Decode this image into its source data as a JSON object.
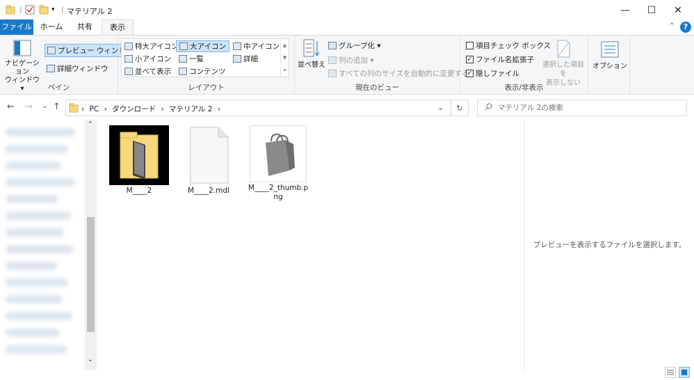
{
  "window": {
    "title": "マテリアル 2",
    "minimize_glyph": "—",
    "maximize_glyph": "☐",
    "close_glyph": "✕"
  },
  "tabs": [
    {
      "label": "ファイル"
    },
    {
      "label": "ホーム"
    },
    {
      "label": "共有"
    },
    {
      "label": "表示"
    }
  ],
  "help_glyph": "?",
  "ribbon": {
    "pane": {
      "label": "ペイン",
      "nav_pane_line1": "ナビゲーション",
      "nav_pane_line2": "ウィンドウ▾",
      "preview_pane": "プレビュー ウィンドウ",
      "details_pane": "詳細ウィンドウ"
    },
    "layout": {
      "label": "レイアウト",
      "items": [
        "特大アイコン",
        "大アイコン",
        "中アイコン",
        "小アイコン",
        "一覧",
        "詳細",
        "並べて表示",
        "コンテンツ"
      ]
    },
    "current_view": {
      "label": "現在のビュー",
      "sort_by": "並べ替え",
      "group_by": "グループ化 ▾",
      "add_columns": "列の追加 ▾",
      "fit_columns": "すべての列のサイズを自動的に変更する"
    },
    "show_hide": {
      "label": "表示/非表示",
      "item_checkboxes": "項目チェック ボックス",
      "item_checkboxes_checked": false,
      "file_extensions": "ファイル名拡張子",
      "file_extensions_checked": true,
      "hidden_items": "隠しファイル",
      "hidden_items_checked": true,
      "hide_selected_line1": "選択した項目を",
      "hide_selected_line2": "表示しない"
    },
    "options": "オプション"
  },
  "nav": {
    "back": "←",
    "forward": "→",
    "recent": "⌄",
    "up": "↑",
    "breadcrumb": [
      "PC",
      "ダウンロード",
      "マテリアル 2"
    ],
    "separator": "›",
    "refresh_glyph": "↻",
    "search_placeholder": "マテリアル 2の検索"
  },
  "files": [
    {
      "name": "M____2",
      "type": "folder"
    },
    {
      "name": "M____2.mdl",
      "type": "file"
    },
    {
      "name": "M____2_thumb.png",
      "type": "image"
    }
  ],
  "preview_message": "プレビューを表示するファイルを選択します。",
  "colors": {
    "accent": "#1979ca",
    "ribbon_bg": "#f5f6f7",
    "selected_bg": "#cce4f7",
    "folder": "#f6d97e"
  }
}
